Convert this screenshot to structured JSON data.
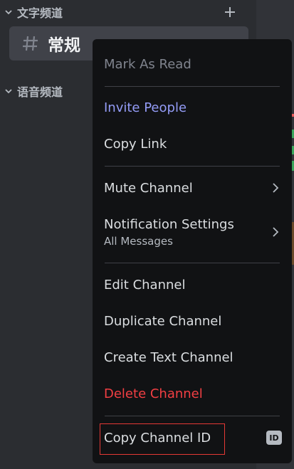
{
  "sidebar": {
    "text_category_label": "文字频道",
    "channel_name": "常规",
    "voice_category_label": "语音频道"
  },
  "context_menu": {
    "mark_as_read": "Mark As Read",
    "invite_people": "Invite People",
    "copy_link": "Copy Link",
    "mute_channel": "Mute Channel",
    "notification_settings": "Notification Settings",
    "notification_settings_value": "All Messages",
    "edit_channel": "Edit Channel",
    "duplicate_channel": "Duplicate Channel",
    "create_text_channel": "Create Text Channel",
    "delete_channel": "Delete Channel",
    "copy_channel_id": "Copy Channel ID",
    "id_badge": "ID"
  },
  "colors": {
    "sidebar_bg": "#2b2d31",
    "menu_bg": "#111214",
    "accent": "#949cf7",
    "danger": "#f23f43",
    "highlight_box": "#e53935"
  },
  "icons": [
    "chevron-down-icon",
    "plus-icon",
    "hash-icon",
    "chevron-right-icon",
    "id-icon"
  ]
}
